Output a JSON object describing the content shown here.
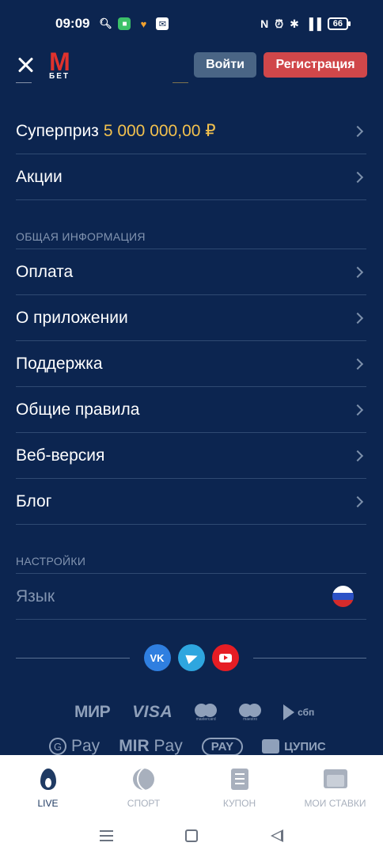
{
  "status": {
    "time": "09:09",
    "battery": "66"
  },
  "header": {
    "login_label": "Войти",
    "register_label": "Регистрация",
    "logo_text": "M",
    "logo_sub": "БЕТ"
  },
  "menu_top": [
    {
      "label": "Суперприз",
      "value": "5 000 000,00 ₽"
    },
    {
      "label": "Акции"
    }
  ],
  "sections": {
    "general": "ОБЩАЯ ИНФОРМАЦИЯ",
    "settings": "НАСТРОЙКИ"
  },
  "menu_general": [
    {
      "label": "Оплата"
    },
    {
      "label": "О приложении"
    },
    {
      "label": "Поддержка"
    },
    {
      "label": "Общие правила"
    },
    {
      "label": "Веб-версия"
    },
    {
      "label": "Блог"
    }
  ],
  "settings": {
    "language_label": "Язык"
  },
  "social": {
    "vk": "VK"
  },
  "payments": {
    "mir": "МИР",
    "visa": "VISA",
    "mastercard": "mastercard",
    "maestro": "maestro",
    "sbp": "сбп",
    "gpay": "Pay",
    "mirpay_mir": "MIR",
    "mirpay_pay": "Pay",
    "samsungpay": "PAY",
    "cupis": "ЦУПИС"
  },
  "tabs": [
    {
      "label": "LIVE",
      "icon": "flame-icon",
      "active": true
    },
    {
      "label": "СПОРТ",
      "icon": "ball-icon",
      "active": false
    },
    {
      "label": "КУПОН",
      "icon": "coupon-icon",
      "active": false
    },
    {
      "label": "МОИ СТАВКИ",
      "icon": "folder-icon",
      "active": false
    }
  ],
  "colors": {
    "background": "#0c2550",
    "accent_red": "#d0474a",
    "prize_gold": "#f2c14e",
    "login_btn": "#4a6585"
  }
}
